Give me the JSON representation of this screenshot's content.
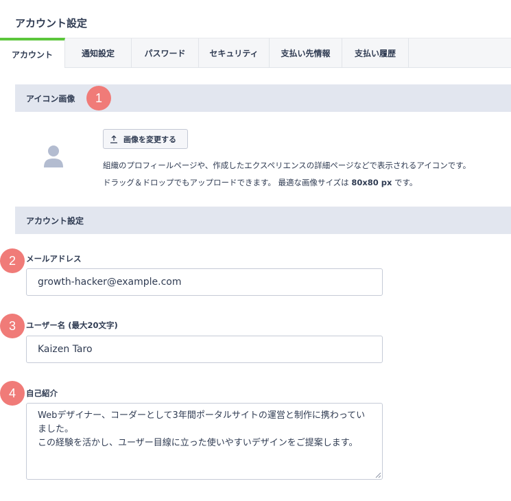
{
  "page": {
    "title": "アカウント設定"
  },
  "tabs": [
    {
      "label": "アカウント",
      "active": true
    },
    {
      "label": "通知設定",
      "active": false
    },
    {
      "label": "パスワード",
      "active": false
    },
    {
      "label": "セキュリティ",
      "active": false
    },
    {
      "label": "支払い先情報",
      "active": false
    },
    {
      "label": "支払い履歴",
      "active": false
    }
  ],
  "icon_section": {
    "heading": "アイコン画像",
    "badge": "1",
    "avatar_icon": "user-silhouette-icon",
    "upload_button": {
      "icon": "upload-arrow-icon",
      "label": "画像を変更する"
    },
    "description_line1": "組織のプロフィールページや、作成したエクスペリエンスの詳細ページなどで表示されるアイコンです。",
    "description_line2_prefix": "ドラッグ＆ドロップでもアップロードできます。 最適な画像サイズは ",
    "description_line2_size": "80x80 px",
    "description_line2_suffix": " です。"
  },
  "account_section": {
    "heading": "アカウント設定",
    "fields": {
      "email": {
        "badge": "2",
        "label": "メールアドレス",
        "value": "growth-hacker@example.com"
      },
      "username": {
        "badge": "3",
        "label": "ユーザー名 (最大20文字)",
        "value": "Kaizen Taro"
      },
      "bio": {
        "badge": "4",
        "label": "自己紹介",
        "value": "Webデザイナー、コーダーとして3年間ポータルサイトの運営と制作に携わっていました。\nこの経験を活かし、ユーザー目線に立った使いやすいデザインをご提案します。"
      }
    }
  },
  "colors": {
    "accent": "#5cc63c",
    "badge": "#f07b78",
    "section_bg": "#e2e6ef",
    "text": "#2f3b52"
  }
}
